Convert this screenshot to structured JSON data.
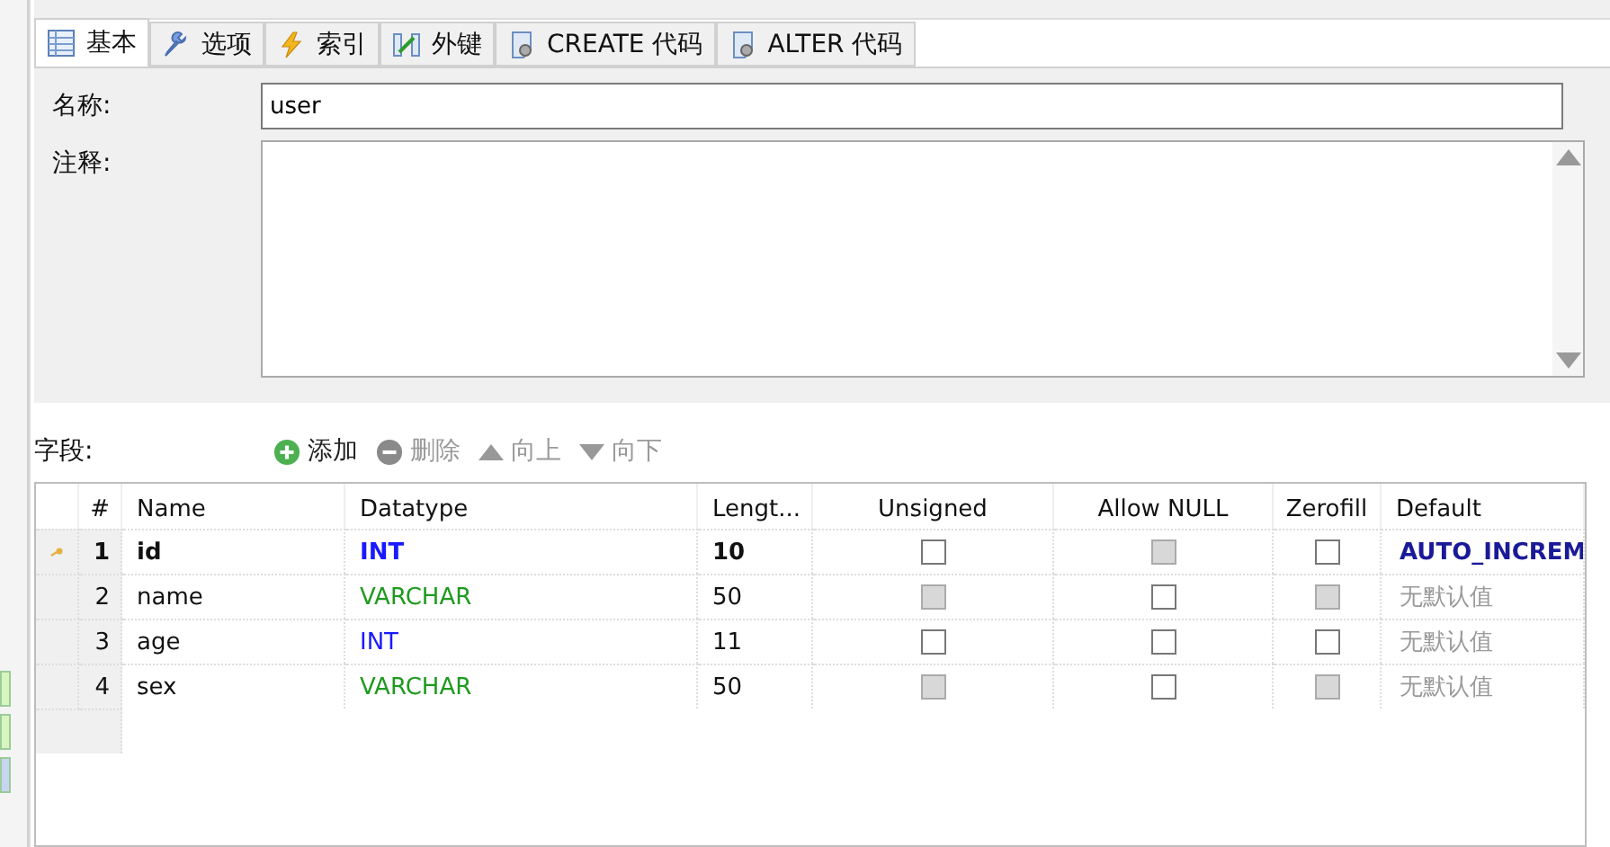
{
  "tabs": [
    {
      "label": "基本",
      "selected": true
    },
    {
      "label": "选项",
      "selected": false
    },
    {
      "label": "索引",
      "selected": false
    },
    {
      "label": "外键",
      "selected": false
    },
    {
      "label": "CREATE 代码",
      "selected": false
    },
    {
      "label": "ALTER 代码",
      "selected": false
    }
  ],
  "form": {
    "name_label": "名称:",
    "name_value": "user",
    "comment_label": "注释:"
  },
  "fields_toolbar": {
    "label": "字段:",
    "buttons": [
      {
        "label": "添加",
        "disabled": false
      },
      {
        "label": "删除",
        "disabled": true
      },
      {
        "label": "向上",
        "disabled": true
      },
      {
        "label": "向下",
        "disabled": true
      }
    ]
  },
  "table": {
    "columns": [
      "#",
      "Name",
      "Datatype",
      "Lengt...",
      "Unsigned",
      "Allow NULL",
      "Zerofill",
      "Default"
    ],
    "rows": [
      {
        "primary_key": true,
        "num": "1",
        "name": "id",
        "datatype": {
          "text": "INT",
          "color": "#1a1aff"
        },
        "length": "10",
        "unsigned": {
          "checked": false,
          "disabled": false
        },
        "allow_null": {
          "checked": false,
          "disabled": true
        },
        "zerofill": {
          "checked": false,
          "disabled": false
        },
        "default": {
          "text": "AUTO_INCREM",
          "kind": "expression"
        }
      },
      {
        "primary_key": false,
        "num": "2",
        "name": "name",
        "datatype": {
          "text": "VARCHAR",
          "color": "#1e9a1e"
        },
        "length": "50",
        "unsigned": {
          "checked": false,
          "disabled": true
        },
        "allow_null": {
          "checked": false,
          "disabled": false
        },
        "zerofill": {
          "checked": false,
          "disabled": true
        },
        "default": {
          "text": "无默认值",
          "kind": "none"
        }
      },
      {
        "primary_key": false,
        "num": "3",
        "name": "age",
        "datatype": {
          "text": "INT",
          "color": "#1a1aff"
        },
        "length": "11",
        "unsigned": {
          "checked": false,
          "disabled": false
        },
        "allow_null": {
          "checked": false,
          "disabled": false
        },
        "zerofill": {
          "checked": false,
          "disabled": false
        },
        "default": {
          "text": "无默认值",
          "kind": "none"
        }
      },
      {
        "primary_key": false,
        "num": "4",
        "name": "sex",
        "datatype": {
          "text": "VARCHAR",
          "color": "#1e9a1e"
        },
        "length": "50",
        "unsigned": {
          "checked": false,
          "disabled": true
        },
        "allow_null": {
          "checked": false,
          "disabled": false
        },
        "zerofill": {
          "checked": false,
          "disabled": true
        },
        "default": {
          "text": "无默认值",
          "kind": "none"
        }
      }
    ]
  }
}
